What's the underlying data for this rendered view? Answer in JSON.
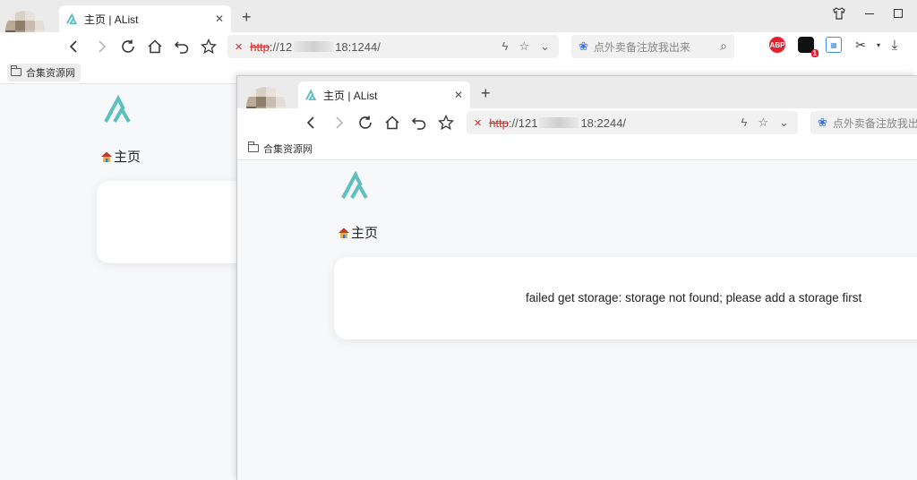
{
  "colors": {
    "accent": "#5bc0be",
    "insecure": "#d92b2b",
    "tabstrip": "#ebebeb"
  },
  "back_window": {
    "tab": {
      "title": "主页 | AList",
      "close": "✕"
    },
    "new_tab": "+",
    "address": {
      "insecure_badge": "✕",
      "scheme": "http",
      "rest_prefix": "://12",
      "host_end": "18:1244/"
    },
    "search_placeholder": "点外卖备注放我出来",
    "search_icon": "⌕",
    "extensions": {
      "abp": "ABP",
      "badge": "1"
    },
    "bookmark": "合集资源网",
    "breadcrumb_home": "主页"
  },
  "front_window": {
    "tab": {
      "title": "主页 | AList",
      "close": "✕"
    },
    "new_tab": "+",
    "address": {
      "insecure_badge": "✕",
      "scheme": "http",
      "rest_prefix": "://121",
      "host_end": "18:2244/"
    },
    "search_placeholder": "点外卖备注放我出",
    "bookmark": "合集资源网",
    "breadcrumb_home": "主页",
    "error_message": "failed get storage: storage not found; please add a storage first"
  }
}
